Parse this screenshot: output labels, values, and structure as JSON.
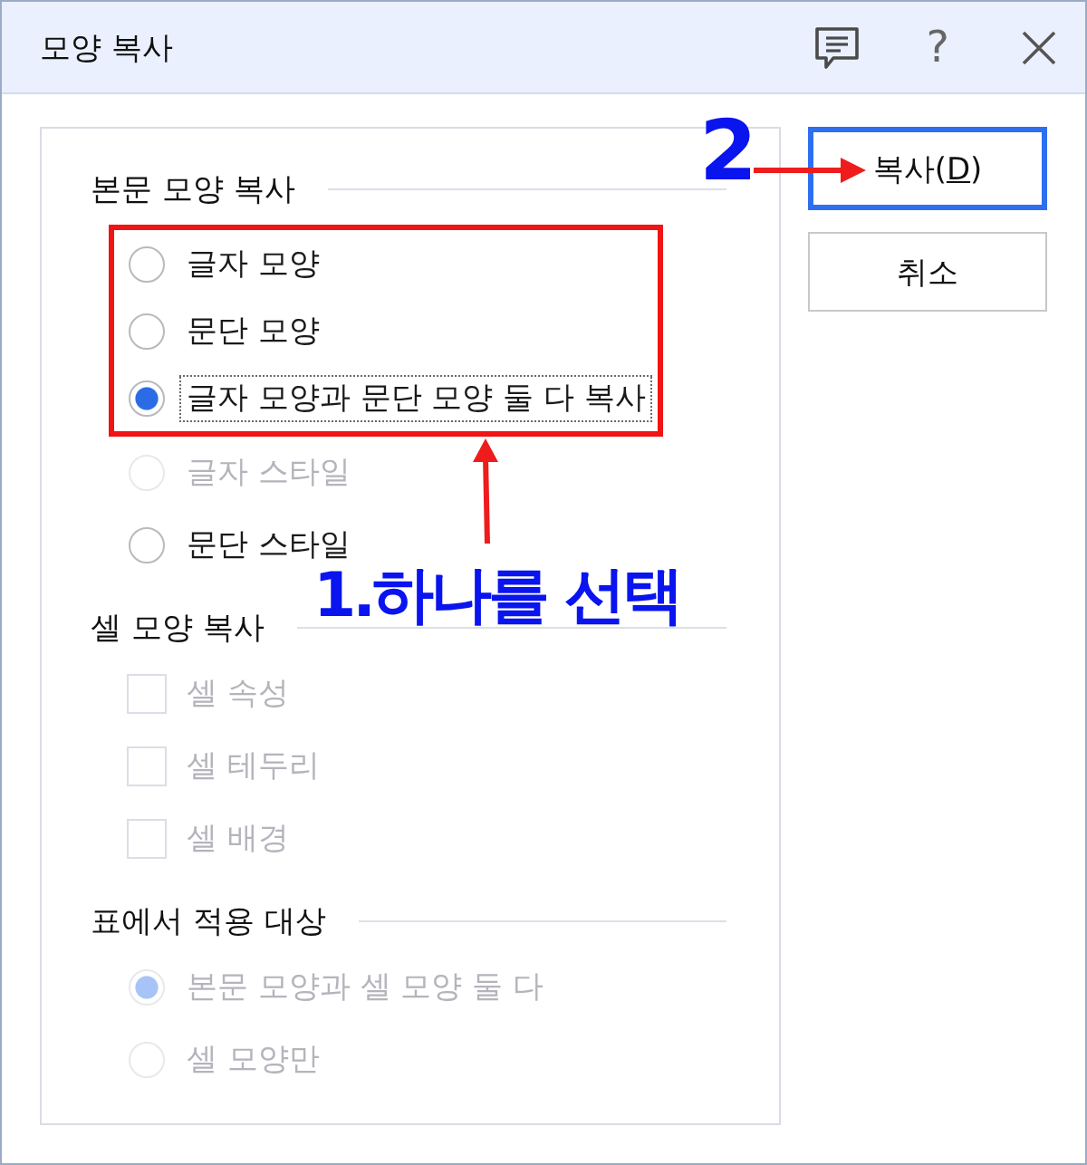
{
  "window": {
    "title": "모양 복사",
    "help": "?"
  },
  "sections": [
    {
      "heading": "본문 모양 복사",
      "options": [
        {
          "kind": "radio",
          "label": "글자 모양",
          "selected": false,
          "disabled": false,
          "focused": false,
          "highlighted": true
        },
        {
          "kind": "radio",
          "label": "문단 모양",
          "selected": false,
          "disabled": false,
          "focused": false,
          "highlighted": true
        },
        {
          "kind": "radio",
          "label": "글자 모양과 문단 모양 둘 다 복사",
          "selected": true,
          "disabled": false,
          "focused": true,
          "highlighted": true
        },
        {
          "kind": "radio",
          "label": "글자 스타일",
          "selected": false,
          "disabled": true,
          "focused": false,
          "highlighted": false
        },
        {
          "kind": "radio",
          "label": "문단 스타일",
          "selected": false,
          "disabled": false,
          "focused": false,
          "highlighted": false
        }
      ]
    },
    {
      "heading": "셀 모양 복사",
      "options": [
        {
          "kind": "checkbox",
          "label": "셀 속성",
          "checked": false,
          "disabled": true,
          "focused": false,
          "highlighted": false
        },
        {
          "kind": "checkbox",
          "label": "셀 테두리",
          "checked": false,
          "disabled": true,
          "focused": false,
          "highlighted": false
        },
        {
          "kind": "checkbox",
          "label": "셀 배경",
          "checked": false,
          "disabled": true,
          "focused": false,
          "highlighted": false
        }
      ]
    },
    {
      "heading": "표에서 적용 대상",
      "options": [
        {
          "kind": "radio",
          "label": "본문 모양과 셀 모양 둘 다",
          "selected": true,
          "disabled": true,
          "focused": false,
          "highlighted": false
        },
        {
          "kind": "radio",
          "label": "셀 모양만",
          "selected": false,
          "disabled": true,
          "focused": false,
          "highlighted": false
        }
      ]
    }
  ],
  "buttons": [
    {
      "label": "복사(",
      "access_key": "D",
      "label_end": ")",
      "default": true
    },
    {
      "label": "취소",
      "default": false
    }
  ],
  "annotations": [
    {
      "kind": "arrow_right",
      "text": "2"
    },
    {
      "kind": "arrow_up",
      "text": "1.하나를 선택"
    }
  ]
}
